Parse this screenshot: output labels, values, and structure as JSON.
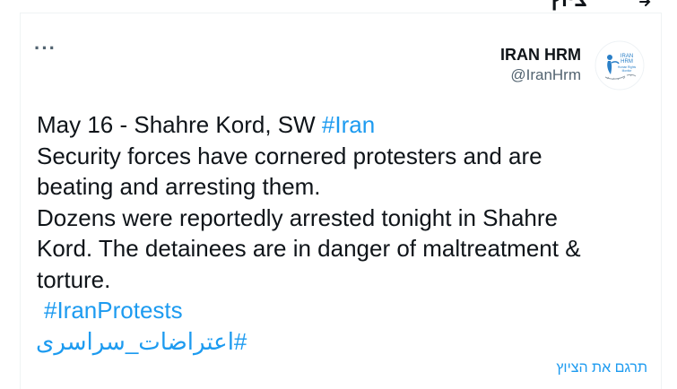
{
  "header": {
    "title": "ציוץ",
    "back_icon": "arrow-right-icon"
  },
  "tweet": {
    "more_label": "···",
    "author": {
      "name": "IRAN HRM",
      "handle": "@IranHrm",
      "avatar_icon": "iran-hrm-logo"
    },
    "text_lines": {
      "l1_prefix": "May 16 - Shahre Kord, SW ",
      "l1_tag": "#Iran",
      "body": "Security forces have cornered protesters and are\nbeating and arresting them.\nDozens were reportedly arrested tonight in Shahre\nKord. The detainees are in danger of maltreatment &\ntorture."
    },
    "hashtag_iranprotests": "#IranProtests",
    "hashtag_persian": "#اعتراضات_سراسری",
    "translate_label": "תרגם את הציוץ"
  },
  "colors": {
    "link": "#1d9bf0",
    "text": "#0f1419",
    "secondary": "#536471",
    "border": "#eff3f4"
  }
}
